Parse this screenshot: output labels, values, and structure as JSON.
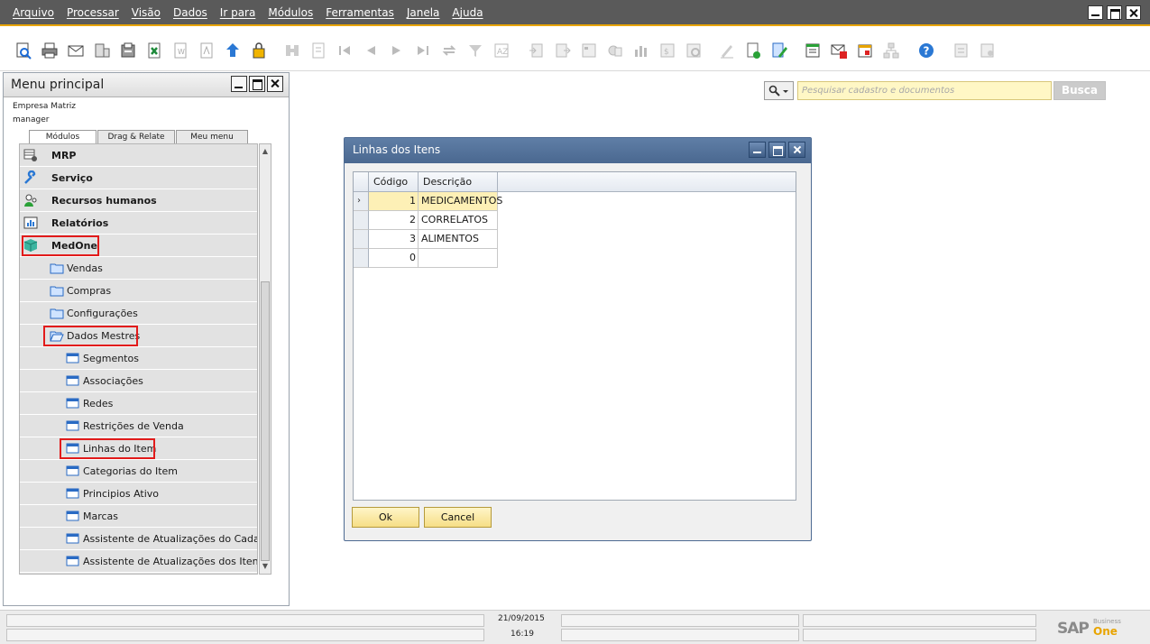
{
  "menu": {
    "items": [
      "Arquivo",
      "Processar",
      "Visão",
      "Dados",
      "Ir para",
      "Módulos",
      "Ferramentas",
      "Janela",
      "Ajuda"
    ]
  },
  "left_panel": {
    "title": "Menu principal",
    "company": "Empresa Matriz",
    "user": "manager",
    "tabs": [
      "Módulos",
      "Drag & Relate",
      "Meu menu"
    ],
    "modules": [
      {
        "label": "MRP",
        "icon": "mrp-icon"
      },
      {
        "label": "Serviço",
        "icon": "wrench-icon"
      },
      {
        "label": "Recursos humanos",
        "icon": "people-icon"
      },
      {
        "label": "Relatórios",
        "icon": "report-icon"
      },
      {
        "label": "MedOne",
        "icon": "cube-icon"
      }
    ],
    "folders": [
      "Vendas",
      "Compras",
      "Configurações",
      "Dados Mestres"
    ],
    "forms": [
      "Segmentos",
      "Associações",
      "Redes",
      "Restrições de Venda",
      "Linhas do Item",
      "Categorias do Item",
      "Principios Ativo",
      "Marcas",
      "Assistente de Atualizações do Cadastro",
      "Assistente de Atualizações dos Itens"
    ]
  },
  "search": {
    "placeholder": "Pesquisar cadastro e documentos",
    "button": "Busca"
  },
  "dialog": {
    "title": "Linhas dos Itens",
    "columns": [
      "Código",
      "Descrição"
    ],
    "rows": [
      {
        "code": "1",
        "desc": "MEDICAMENTOS"
      },
      {
        "code": "2",
        "desc": "CORRELATOS"
      },
      {
        "code": "3",
        "desc": "ALIMENTOS"
      },
      {
        "code": "0",
        "desc": ""
      }
    ],
    "ok": "Ok",
    "cancel": "Cancel"
  },
  "status": {
    "date": "21/09/2015",
    "time": "16:19",
    "brand": "SAP",
    "brand_sub1": "Business",
    "brand_sub2": "One"
  },
  "colors": {
    "menubar": "#5a5a5a",
    "accent": "#e8a400",
    "highlight_border": "#e21b1b",
    "dialog_title": "#4d6a92",
    "button_fill": "#f6de86"
  }
}
